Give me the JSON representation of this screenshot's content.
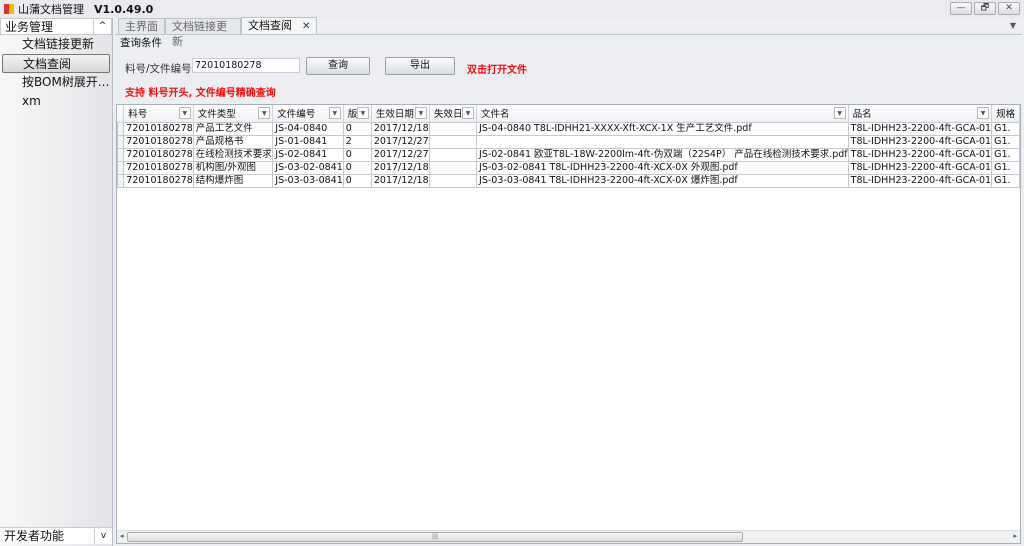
{
  "app": {
    "title": "山蒲文档管理",
    "version": "V1.0.49.0"
  },
  "window_controls": {
    "minimize": "—",
    "restore": "🗗",
    "close": "✕"
  },
  "sidebar": {
    "section": "业务管理",
    "items": [
      {
        "label": "文档链接更新"
      },
      {
        "label": "文档查阅",
        "selected": true
      },
      {
        "label": "按BOM树展开..."
      },
      {
        "label": "xm"
      }
    ],
    "footer": "开发者功能"
  },
  "tabs": [
    {
      "label": "主界面"
    },
    {
      "label": "文档链接更新"
    },
    {
      "label": "文档查阅",
      "active": true
    }
  ],
  "query": {
    "group_label": "查询条件",
    "field_label": "料号/文件编号",
    "field_value": "72010180278",
    "search_label": "查询",
    "export_label": "导出",
    "open_hint": "双击打开文件",
    "support_hint": "支持  料号开头, 文件编号精确查询"
  },
  "grid": {
    "columns": [
      "料号",
      "文件类型",
      "文件编号",
      "版本",
      "生效日期",
      "失效日期",
      "文件名",
      "品名",
      "规格"
    ],
    "rows": [
      [
        "72010180278",
        "产品工艺文件",
        "JS-04-0840",
        "0",
        "2017/12/18",
        "",
        "JS-04-0840  T8L-IDHH21-XXXX-Xft-XCX-1X 生产工艺文件.pdf",
        "T8L-IDHH23-2200-4ft-GCA-01",
        "G1."
      ],
      [
        "72010180278",
        "产品规格书",
        "JS-01-0841",
        "2",
        "2017/12/27",
        "",
        "",
        "T8L-IDHH23-2200-4ft-GCA-01",
        "G1."
      ],
      [
        "72010180278",
        "在线检测技术要求",
        "JS-02-0841",
        "0",
        "2017/12/27",
        "",
        "JS-02-0841 欧亚T8L-18W-2200lm-4ft-伪双端（22S4P） 产品在线检测技术要求.pdf",
        "T8L-IDHH23-2200-4ft-GCA-01",
        "G1."
      ],
      [
        "72010180278",
        "机构图/外观图",
        "JS-03-02-0841",
        "0",
        "2017/12/18",
        "",
        "JS-03-02-0841  T8L-IDHH23-2200-4ft-XCX-0X 外观图.pdf",
        "T8L-IDHH23-2200-4ft-GCA-01",
        "G1."
      ],
      [
        "72010180278",
        "结构爆炸图",
        "JS-03-03-0841",
        "0",
        "2017/12/18",
        "",
        "JS-03-03-0841  T8L-IDHH23-2200-4ft-XCX-0X 爆炸图.pdf",
        "T8L-IDHH23-2200-4ft-GCA-01",
        "G1."
      ]
    ]
  },
  "colors": {
    "hint": "#ee1111"
  }
}
